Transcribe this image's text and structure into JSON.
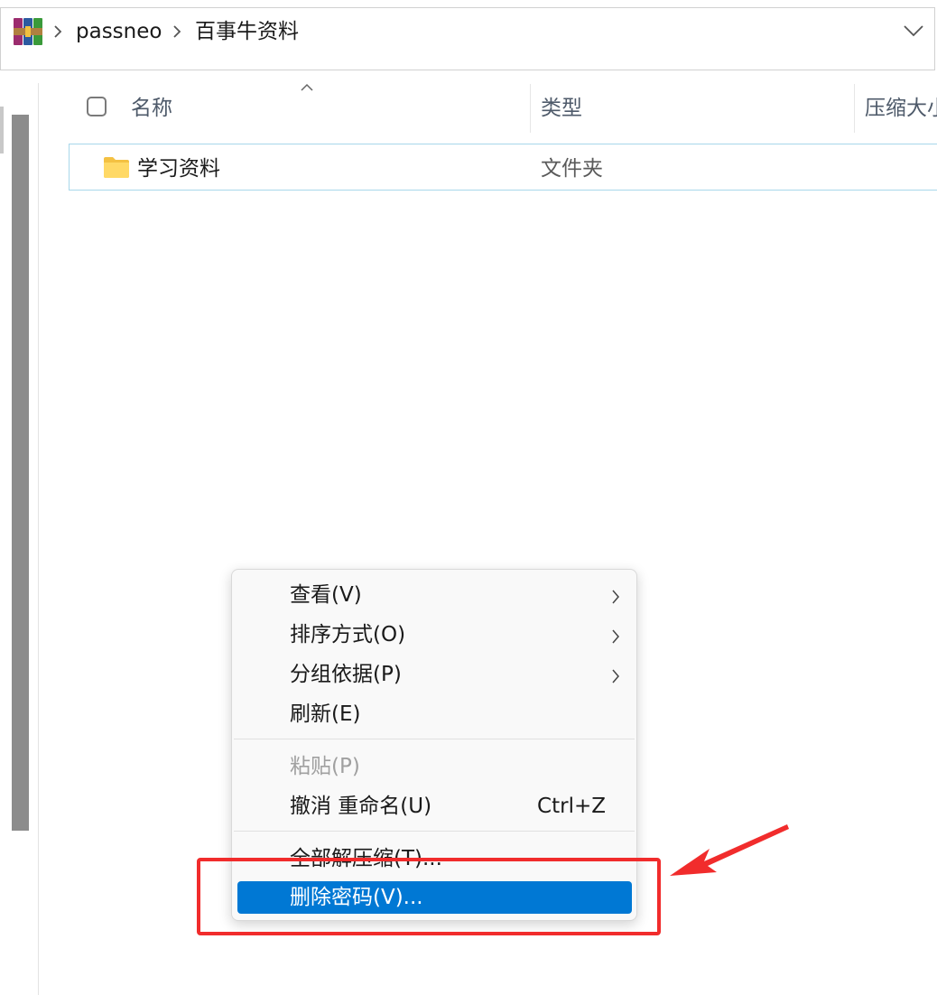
{
  "address_bar": {
    "crumbs": [
      "passneo",
      "百事牛资料"
    ]
  },
  "file_list": {
    "columns": [
      "名称",
      "类型",
      "压缩大小"
    ],
    "rows": [
      {
        "name": "学习资料",
        "type": "文件夹",
        "icon": "folder-icon"
      }
    ]
  },
  "context_menu": {
    "items": [
      {
        "label": "查看(V)",
        "submenu": true,
        "enabled": true
      },
      {
        "label": "排序方式(O)",
        "submenu": true,
        "enabled": true
      },
      {
        "label": "分组依据(P)",
        "submenu": true,
        "enabled": true
      },
      {
        "label": "刷新(E)",
        "submenu": false,
        "enabled": true
      },
      {
        "label": "粘贴(P)",
        "submenu": false,
        "enabled": false
      },
      {
        "label": "撤消 重命名(U)",
        "shortcut": "Ctrl+Z",
        "submenu": false,
        "enabled": true
      },
      {
        "label": "全部解压缩(T)...",
        "submenu": false,
        "enabled": true
      },
      {
        "label": "删除密码(V)...",
        "submenu": false,
        "enabled": true,
        "highlighted": true
      }
    ]
  },
  "colors": {
    "highlight": "#0078d4",
    "annotation": "#f12c2c",
    "folder": "#ffd15a"
  }
}
